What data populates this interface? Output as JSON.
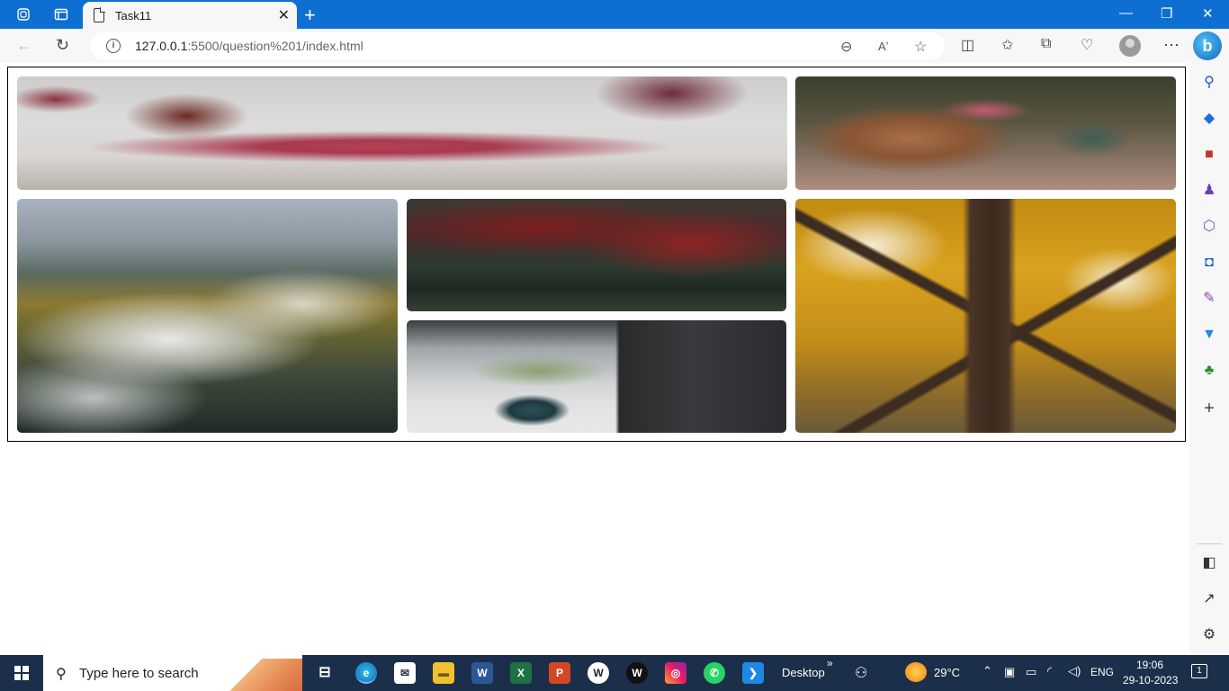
{
  "browser": {
    "tab_title": "Task11",
    "new_tab_label": "+",
    "tab_close_label": "✕",
    "url_host": "127.0.0.1",
    "url_path": ":5500/question%201/index.html",
    "window_controls": {
      "minimize": "—",
      "restore": "❐",
      "close": "✕"
    }
  },
  "toolbar_icons": [
    "back-icon",
    "refresh-icon",
    "info-icon",
    "zoom-out-icon",
    "read-aloud-icon",
    "favorite-star-icon",
    "split-screen-icon",
    "favorites-icon",
    "collections-icon",
    "browser-essentials-icon",
    "profile-avatar",
    "more-menu-icon",
    "bing-copilot-icon"
  ],
  "sidebar_icons": [
    "search-icon",
    "shopping-tag-icon",
    "tools-briefcase-icon",
    "games-icon",
    "office-icon",
    "outlook-icon",
    "designer-icon",
    "drop-icon",
    "tree-icon",
    "add-icon",
    "sidebar-toggle-icon",
    "open-external-icon",
    "settings-icon"
  ],
  "gallery": {
    "images": [
      {
        "subject": "pink magnolia flower blurred"
      },
      {
        "subject": "picnic basket on blanket"
      },
      {
        "subject": "white wildflowers in field"
      },
      {
        "subject": "red autumn trees"
      },
      {
        "subject": "plant in vase on table"
      },
      {
        "subject": "yellow autumn tree"
      }
    ]
  },
  "taskbar": {
    "search_placeholder": "Type here to search",
    "desktop_label": "Desktop",
    "desktop_chevron": "»",
    "temperature": "29°C",
    "language": "ENG",
    "time": "19:06",
    "date": "29-10-2023",
    "notification_count": "1",
    "apps": [
      "task-view-icon",
      "edge-icon",
      "mail-icon",
      "file-explorer-icon",
      "word-icon",
      "excel-icon",
      "powerpoint-icon",
      "wordpress-icon",
      "wordpress-alt-icon",
      "instagram-icon",
      "whatsapp-icon",
      "vscode-icon"
    ]
  }
}
